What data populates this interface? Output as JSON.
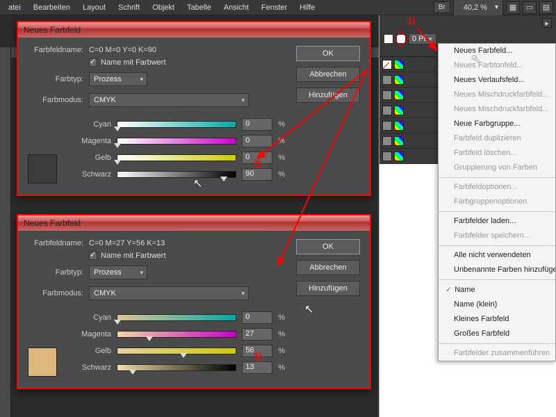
{
  "menubar": [
    "atei",
    "Bearbeiten",
    "Layout",
    "Schrift",
    "Objekt",
    "Tabelle",
    "Ansicht",
    "Fenster",
    "Hilfe"
  ],
  "zoom": "40,2 %",
  "stroke_pt": "0 Pt",
  "annotations": {
    "a1": "1)",
    "a2": "2)",
    "a3": "3)"
  },
  "dialog1": {
    "title": "Neues Farbfeld",
    "name_label": "Farbfeldname:",
    "name_value": "C=0 M=0 Y=0 K=90",
    "name_with_value": "Name mit Farbwert",
    "type_label": "Farbtyp:",
    "type_value": "Prozess",
    "mode_label": "Farbmodus:",
    "mode_value": "CMYK",
    "sliders": {
      "c": {
        "label": "Cyan",
        "value": "0"
      },
      "m": {
        "label": "Magenta",
        "value": "0"
      },
      "y": {
        "label": "Gelb",
        "value": "0"
      },
      "k": {
        "label": "Schwarz",
        "value": "90"
      }
    },
    "pct": "%",
    "buttons": {
      "ok": "OK",
      "cancel": "Abbrechen",
      "add": "Hinzufügen"
    },
    "preview": "#3c3c3c"
  },
  "dialog2": {
    "title": "Neues Farbfeld",
    "name_label": "Farbfeldname:",
    "name_value": "C=0 M=27 Y=56 K=13",
    "name_with_value": "Name mit Farbwert",
    "type_label": "Farbtyp:",
    "type_value": "Prozess",
    "mode_label": "Farbmodus:",
    "mode_value": "CMYK",
    "sliders": {
      "c": {
        "label": "Cyan",
        "value": "0"
      },
      "m": {
        "label": "Magenta",
        "value": "27"
      },
      "y": {
        "label": "Gelb",
        "value": "56"
      },
      "k": {
        "label": "Schwarz",
        "value": "13"
      }
    },
    "pct": "%",
    "buttons": {
      "ok": "OK",
      "cancel": "Abbrechen",
      "add": "Hinzufügen"
    },
    "preview": "#ddb77b"
  },
  "flymenu": [
    {
      "t": "Neues Farbfeld...",
      "d": false
    },
    {
      "t": "Neues Farbtonfeld...",
      "d": true
    },
    {
      "t": "Neues Verlaufsfeld...",
      "d": false
    },
    {
      "t": "Neues Mischdruckfarbfeld...",
      "d": true
    },
    {
      "t": "Neues Mischdruckfarbfeld...",
      "d": true
    },
    {
      "t": "Neue Farbgruppe...",
      "d": false
    },
    {
      "t": "Farbfeld duplizieren",
      "d": true
    },
    {
      "t": "Farbfeld löschen...",
      "d": true
    },
    {
      "t": "Gruppierung von Farben",
      "d": true
    },
    {
      "sep": true
    },
    {
      "t": "Farbfeldoptionen...",
      "d": true
    },
    {
      "t": "Farbgruppenoptionen",
      "d": true
    },
    {
      "sep": true
    },
    {
      "t": "Farbfelder laden...",
      "d": false
    },
    {
      "t": "Farbfelder speichern...",
      "d": true
    },
    {
      "sep": true
    },
    {
      "t": "Alle nicht verwendeten",
      "d": false
    },
    {
      "t": "Unbenannte Farben hinzufügen",
      "d": false
    },
    {
      "sep": true
    },
    {
      "t": "Name",
      "d": false,
      "chk": true
    },
    {
      "t": "Name (klein)",
      "d": false
    },
    {
      "t": "Kleines Farbfeld",
      "d": false
    },
    {
      "t": "Großes Farbfeld",
      "d": false
    },
    {
      "sep": true
    },
    {
      "t": "Farbfelder zusammenführen",
      "d": true
    }
  ]
}
